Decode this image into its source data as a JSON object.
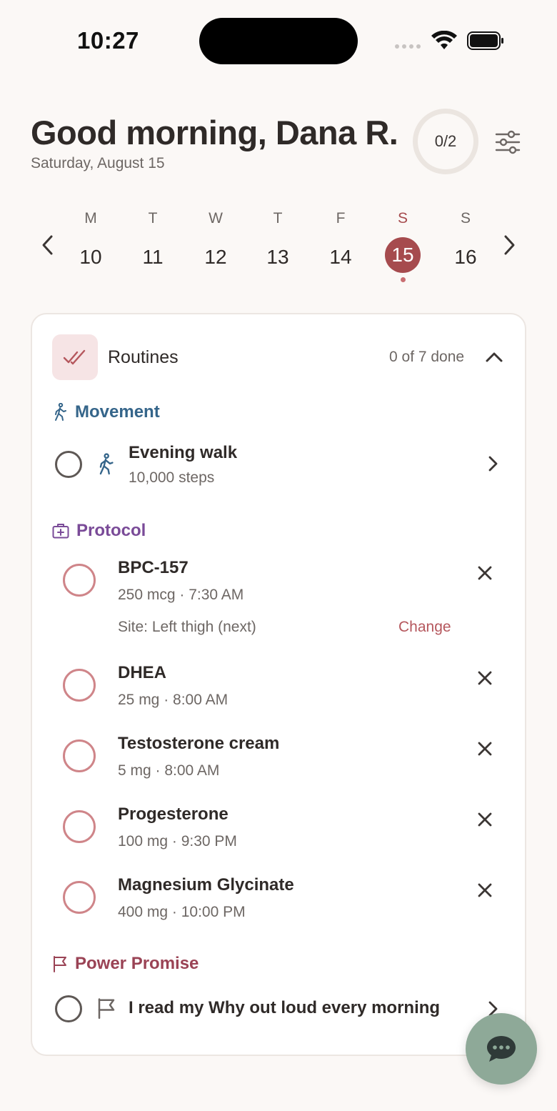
{
  "status_bar": {
    "time": "10:27"
  },
  "header": {
    "greeting": "Good morning, Dana R.",
    "date": "Saturday, August 15",
    "progress_label": "0/2"
  },
  "week": {
    "days": [
      {
        "letter": "M",
        "num": "10"
      },
      {
        "letter": "T",
        "num": "11"
      },
      {
        "letter": "W",
        "num": "12"
      },
      {
        "letter": "T",
        "num": "13"
      },
      {
        "letter": "F",
        "num": "14"
      },
      {
        "letter": "S",
        "num": "15",
        "selected": true
      },
      {
        "letter": "S",
        "num": "16"
      }
    ]
  },
  "routines": {
    "title": "Routines",
    "count": "0 of 7 done",
    "movement": {
      "title": "Movement",
      "items": [
        {
          "title": "Evening walk",
          "sub": "10,000 steps"
        }
      ]
    },
    "protocol": {
      "title": "Protocol",
      "items": [
        {
          "title": "BPC-157",
          "sub": "250 mcg · 7:30 AM",
          "site": "Site: Left thigh (next)",
          "change": "Change"
        },
        {
          "title": "DHEA",
          "sub": "25 mg · 8:00 AM"
        },
        {
          "title": "Testosterone cream",
          "sub": "5 mg · 8:00 AM"
        },
        {
          "title": "Progesterone",
          "sub": "100 mg · 9:30 PM"
        },
        {
          "title": "Magnesium Glycinate",
          "sub": "400 mg · 10:00 PM"
        }
      ]
    },
    "power_promise": {
      "title": "Power Promise",
      "items": [
        {
          "title": "I read my Why out loud every morning"
        }
      ]
    }
  },
  "colors": {
    "accent": "#a64b4e",
    "movement": "#35658a",
    "protocol": "#7a4b98",
    "power": "#9a4355",
    "fab": "#8ea998"
  }
}
